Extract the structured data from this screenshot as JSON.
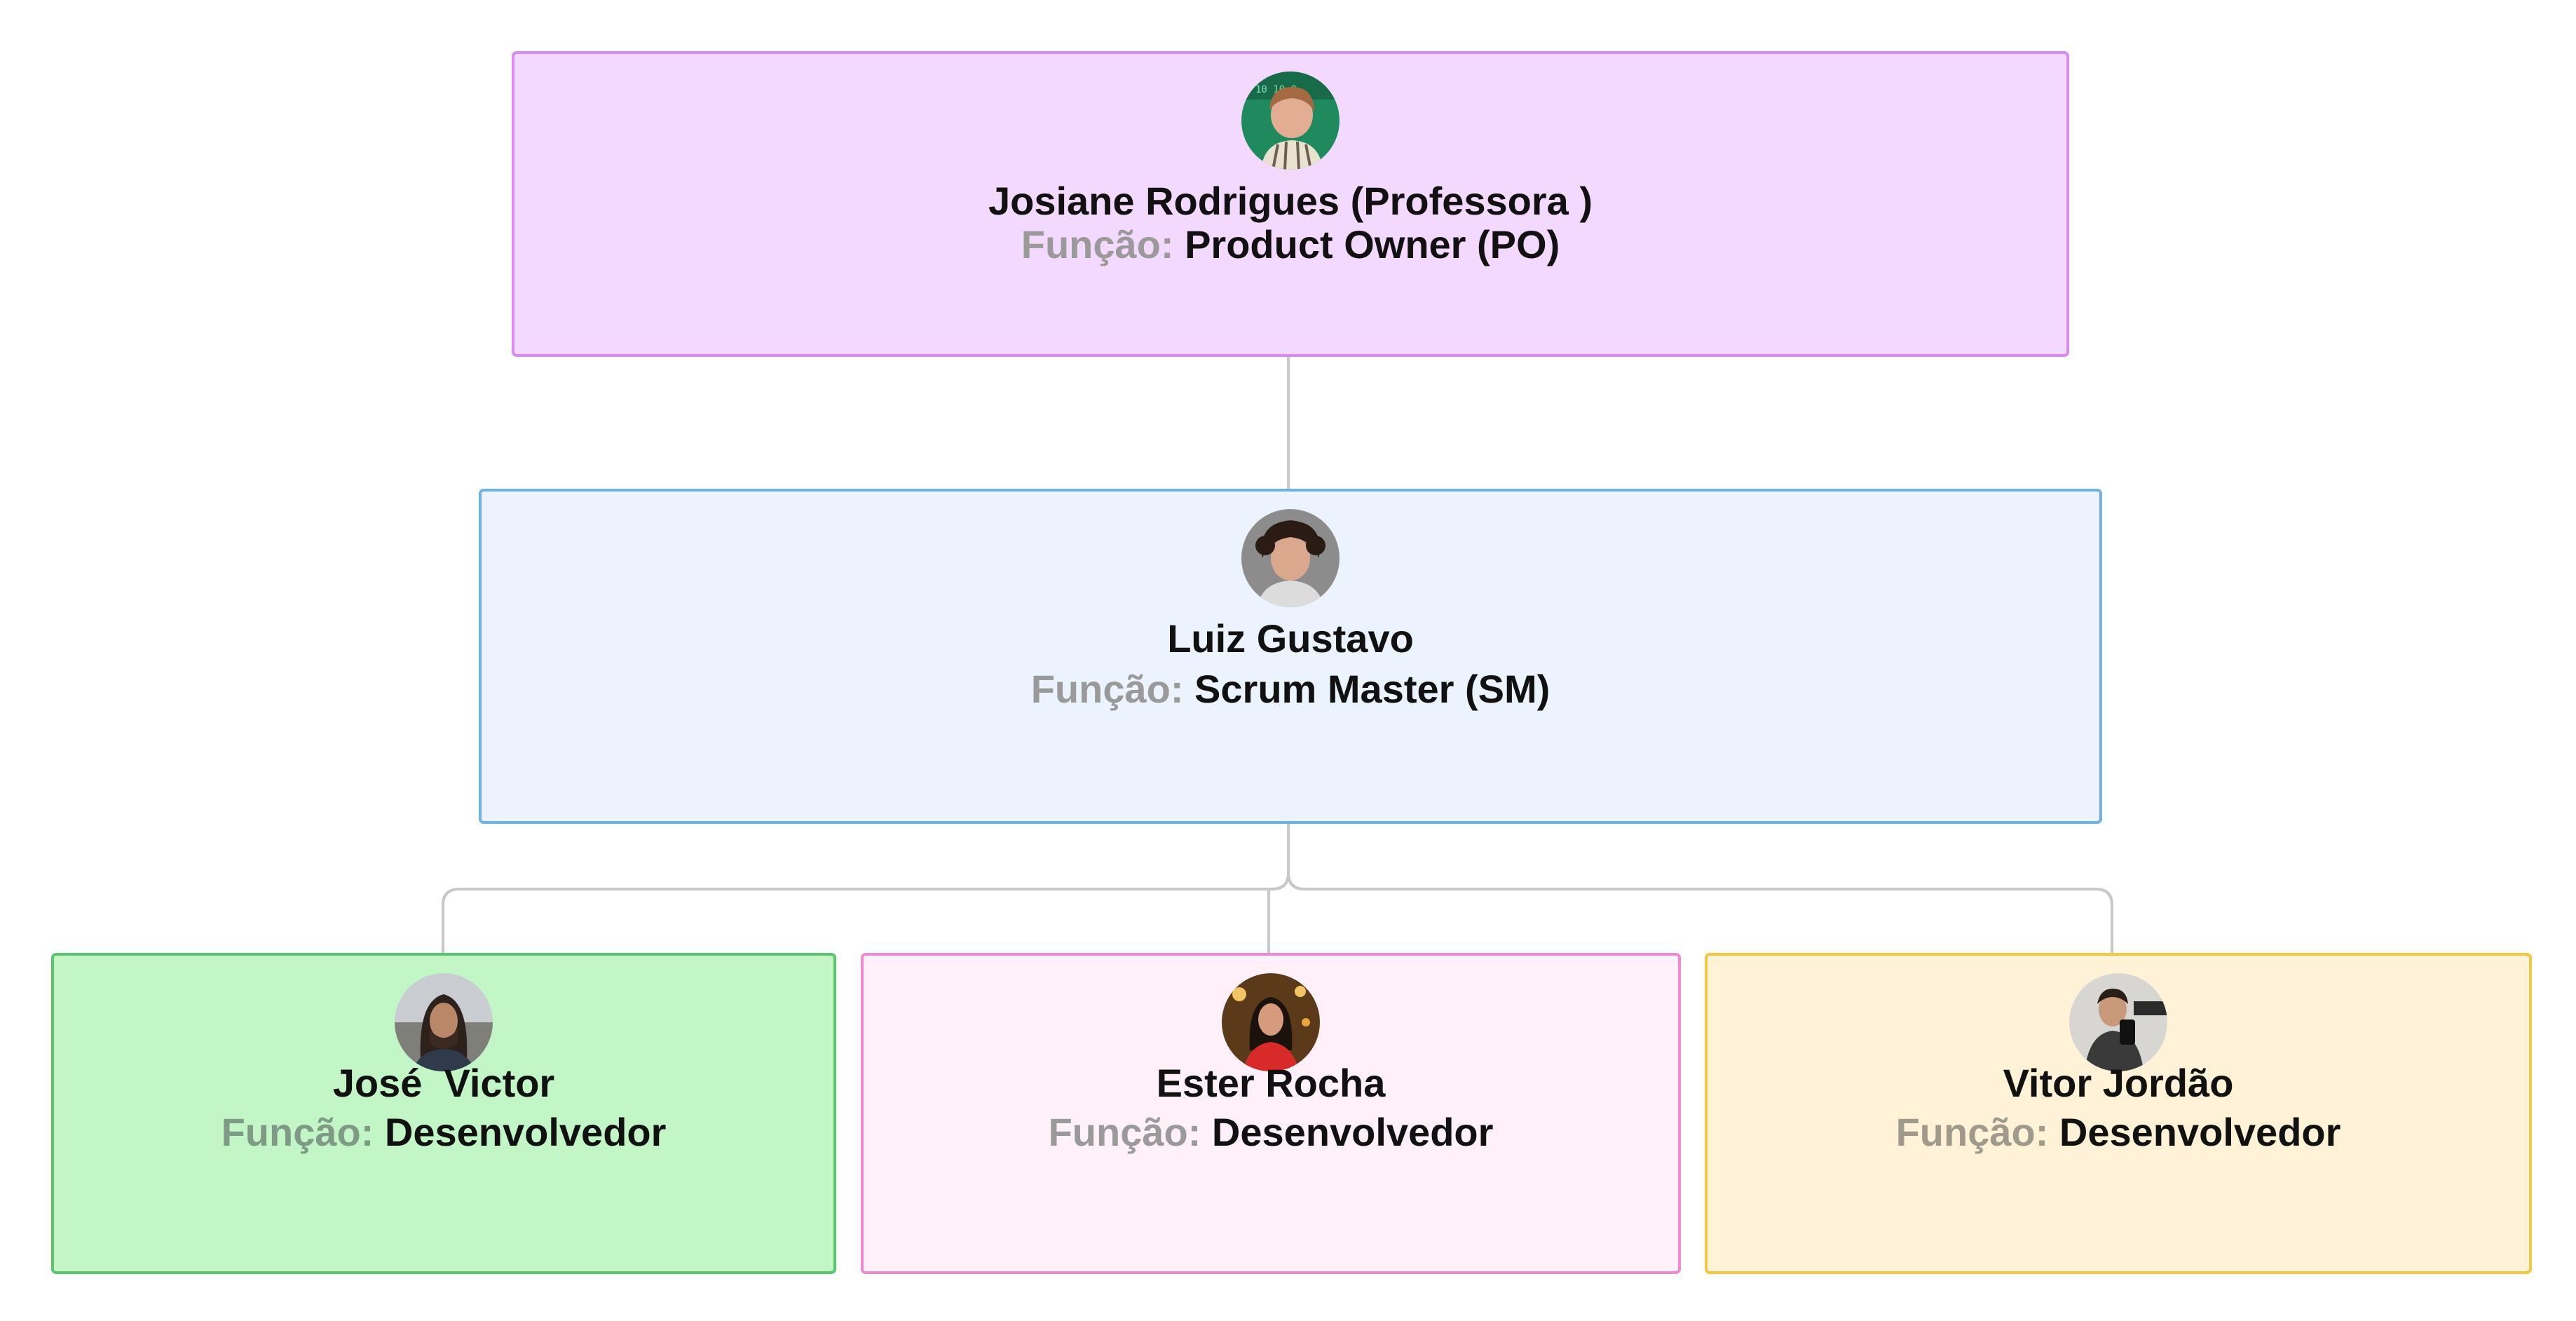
{
  "diagram": {
    "po": {
      "name": "Josiane Rodrigues (Professora )",
      "role_label": "Função:",
      "role_value": "Product Owner (PO)"
    },
    "sm": {
      "name": "Luiz Gustavo",
      "role_label": "Função:",
      "role_value": "Scrum Master (SM)"
    },
    "devs": [
      {
        "name": "José  Victor",
        "role_label": "Função:",
        "role_value": "Desenvolvedor"
      },
      {
        "name": "Ester Rocha",
        "role_label": "Função:",
        "role_value": "Desenvolvedor"
      },
      {
        "name": "Vitor Jordão",
        "role_label": "Função:",
        "role_value": "Desenvolvedor"
      }
    ]
  },
  "colors": {
    "po_fill": "#f2d9fd",
    "po_border": "#d98af3",
    "sm_fill": "#eaf3fe",
    "sm_border": "#6fb0ee",
    "dev1_fill": "#c2f6c7",
    "dev1_border": "#5cc46a",
    "dev2_fill": "#fff0fa",
    "dev2_border": "#ef8ad3",
    "dev3_fill": "#fff2d6",
    "dev3_border": "#f2c744",
    "connector": "#c8c8c8"
  }
}
